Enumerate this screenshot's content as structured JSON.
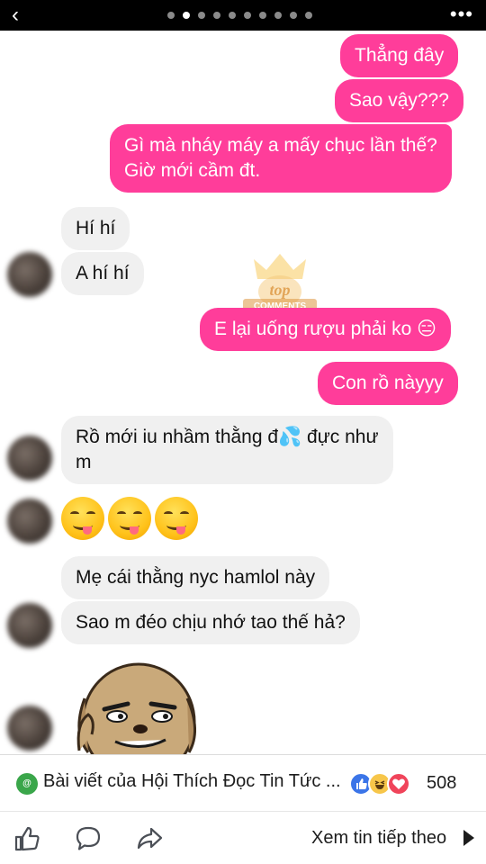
{
  "topbar": {
    "back_icon": "chevron-left-icon",
    "page_dots": 10,
    "active_dot": 1,
    "more_label": "•••"
  },
  "watermark": {
    "text": "top",
    "subtext": "COMMENTS"
  },
  "messages": [
    {
      "side": "out",
      "text": "Thẳng đây"
    },
    {
      "side": "out",
      "text": "Sao vậy???"
    },
    {
      "side": "out",
      "lines": [
        "Gì mà nháy máy a mấy chục lần thế?",
        "Giờ mới cầm đt."
      ]
    },
    {
      "side": "in",
      "text": "Hí hí"
    },
    {
      "side": "in",
      "text": "A hí hí"
    },
    {
      "side": "out",
      "text": "E lại uống rượu phải ko 😑"
    },
    {
      "side": "out",
      "text": "Con rồ nàyyy"
    },
    {
      "side": "in",
      "lines": [
        "Rồ mới iu nhầm thằng đ💦 đực như",
        "m"
      ]
    },
    {
      "side": "in",
      "emoji": "yum-face-emoji",
      "count": 3
    },
    {
      "side": "in",
      "text": "Mẹ cái thằng nyc hamlol này"
    },
    {
      "side": "in",
      "text": "Sao m đéo chịu nhớ tao thế hả?"
    },
    {
      "side": "in",
      "sticker": "smirking-dog-sticker"
    }
  ],
  "footer": {
    "post_title": "Bài viết của Hội Thích Đọc Tin Tức ...",
    "reaction_count": "508",
    "reactions": [
      "like",
      "haha",
      "love"
    ],
    "next_label": "Xem tin tiếp theo"
  },
  "colors": {
    "outgoing_bubble": "#ff3d9a",
    "incoming_bubble": "#f0f0f0",
    "topbar": "#000000"
  }
}
